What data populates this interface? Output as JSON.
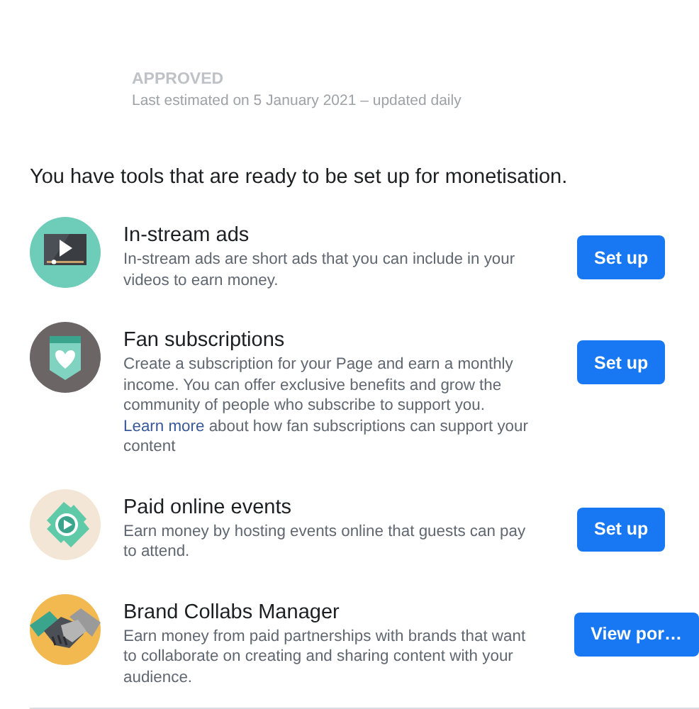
{
  "status": {
    "label": "APPROVED",
    "note": "Last estimated on 5 January 2021 – updated daily"
  },
  "heading": "You have tools that are ready to be set up for monetisation.",
  "tools": [
    {
      "title": "In-stream ads",
      "description": "In-stream ads are short ads that you can include in your videos to earn money.",
      "button": "Set up"
    },
    {
      "title": "Fan subscriptions",
      "description": "Create a subscription for your Page and earn a monthly income. You can offer exclusive benefits and grow the community of people who subscribe to support you.",
      "link": "Learn more",
      "description_end": "about how fan subscriptions can support your content",
      "button": "Set up"
    },
    {
      "title": "Paid online events",
      "description": "Earn money by hosting events online that guests can pay to attend.",
      "button": "Set up"
    },
    {
      "title": "Brand Collabs Manager",
      "description": "Earn money from paid partnerships with brands that want to collaborate on creating and sharing content with your audience.",
      "button": "View por…"
    }
  ]
}
